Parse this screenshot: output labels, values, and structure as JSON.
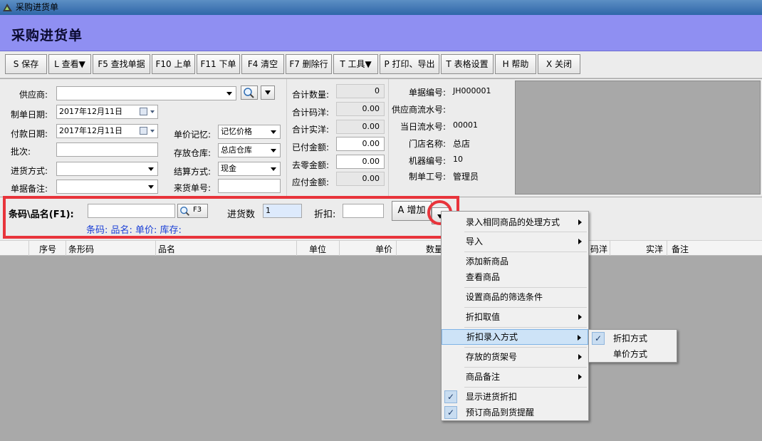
{
  "window_title": "采购进货单",
  "header_title": "采购进货单",
  "toolbar": {
    "save": "S 保存",
    "view": "L 查看▼",
    "find": "F5 查找单据",
    "prev": "F10 上单",
    "next": "F11 下单",
    "clear": "F4 清空",
    "delete_row": "F7 删除行",
    "tools": "T 工具▼",
    "print": "P 打印、导出",
    "table_settings": "T 表格设置",
    "help": "H 帮助",
    "close": "X 关闭"
  },
  "form": {
    "supplier_label": "供应商:",
    "supplier_value": "",
    "create_date_label": "制单日期:",
    "create_date_value": "2017年12月11日",
    "pay_date_label": "付款日期:",
    "pay_date_value": "2017年12月11日",
    "batch_label": "批次:",
    "batch_value": "",
    "purchase_method_label": "进货方式:",
    "purchase_method_value": "",
    "doc_note_label": "单据备注:",
    "doc_note_value": "",
    "price_memory_label": "单价记忆:",
    "price_memory_value": "记忆价格",
    "warehouse_label": "存放仓库:",
    "warehouse_value": "总店仓库",
    "settle_label": "结算方式:",
    "settle_value": "现金",
    "source_no_label": "来货单号:",
    "source_no_value": ""
  },
  "totals": {
    "qty_label": "合计数量:",
    "qty_value": "0",
    "code_price_label": "合计码洋:",
    "code_price_value": "0.00",
    "actual_label": "合计实洋:",
    "actual_value": "0.00",
    "paid_label": "已付金额:",
    "paid_value": "0.00",
    "rounding_label": "去零金额:",
    "rounding_value": "0.00",
    "payable_label": "应付金额:",
    "payable_value": "0.00"
  },
  "docinfo": {
    "doc_no_label": "单据编号:",
    "doc_no_value": "JH000001",
    "supplier_serial_label": "供应商流水号:",
    "supplier_serial_value": "",
    "daily_serial_label": "当日流水号:",
    "daily_serial_value": "00001",
    "store_label": "门店名称:",
    "store_value": "总店",
    "machine_label": "机器编号:",
    "machine_value": "10",
    "operator_label": "制单工号:",
    "operator_value": "管理员"
  },
  "entry": {
    "barcode_label": "条码\\品名(F1):",
    "barcode_value": "",
    "search_btn": "F3",
    "qty_label": "进货数",
    "qty_value": "1",
    "discount_label": "折扣:",
    "discount_value": "",
    "add_btn": "A 增加",
    "info_line": "条码: 品名: 单价: 库存:"
  },
  "grid": {
    "columns": [
      "序号",
      "条形码",
      "品名",
      "单位",
      "单价",
      "数量",
      "码洋",
      "实洋",
      "备注"
    ]
  },
  "menu": {
    "items": [
      {
        "label": "录入相同商品的处理方式",
        "submenu": true
      },
      {
        "label": "导入",
        "submenu": true
      },
      {
        "label": "添加新商品",
        "submenu": false
      },
      {
        "label": "查看商品",
        "submenu": false
      },
      {
        "label": "设置商品的筛选条件",
        "submenu": false
      },
      {
        "label": "折扣取值",
        "submenu": true
      },
      {
        "label": "折扣录入方式",
        "submenu": true,
        "highlighted": true
      },
      {
        "label": "存放的货架号",
        "submenu": true
      },
      {
        "label": "商品备注",
        "submenu": true
      },
      {
        "label": "显示进货折扣",
        "checked": true
      },
      {
        "label": "预订商品到货提醒",
        "checked": true
      }
    ]
  },
  "submenu": {
    "items": [
      {
        "label": "折扣方式",
        "checked": true
      },
      {
        "label": "单价方式",
        "checked": false
      }
    ]
  },
  "colors": {
    "header_bg": "#8f8ff2",
    "annotation_red": "#e8343b",
    "info_blue": "#1a3fd6"
  }
}
